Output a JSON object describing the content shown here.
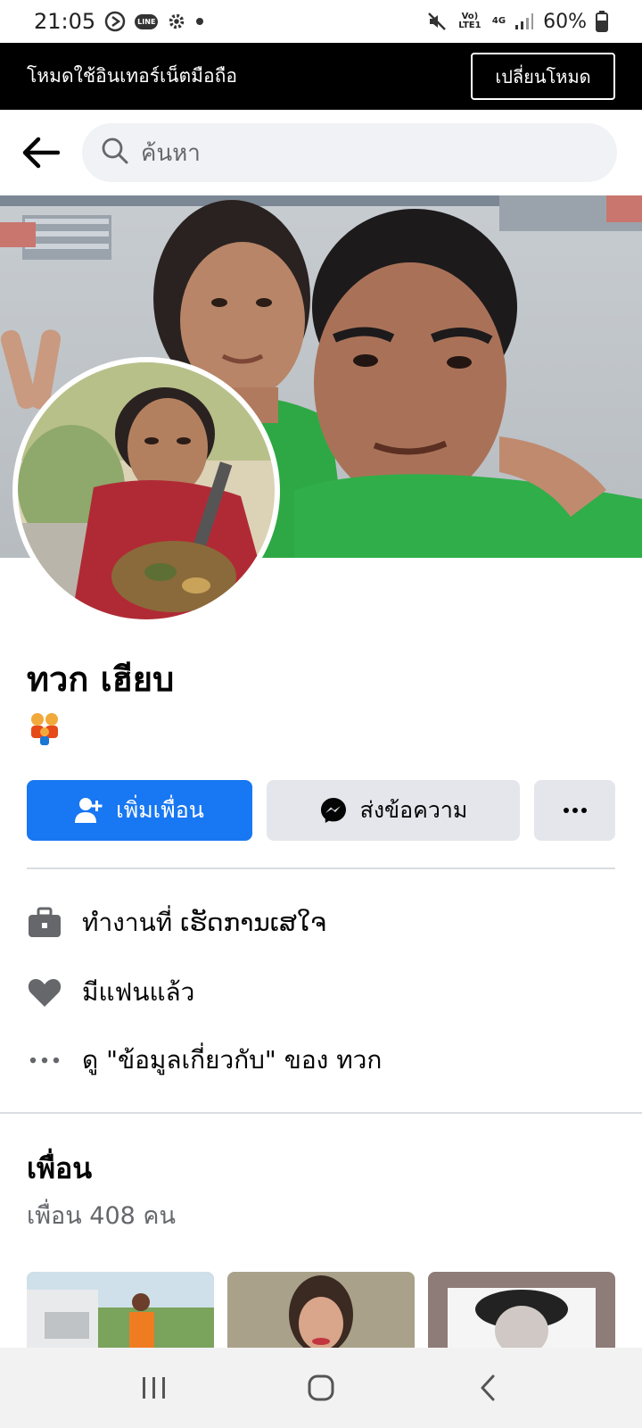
{
  "status_bar": {
    "time": "21:05",
    "line_label": "LINE",
    "volte_label": "Vo) LTE1",
    "network_label": "4G",
    "battery": "60%"
  },
  "mode_banner": {
    "text": "โหมดใช้อินเทอร์เน็ตมือถือ",
    "button": "เปลี่ยนโหมด"
  },
  "search": {
    "placeholder": "ค้นหา"
  },
  "profile": {
    "name": "ทวก เฮียบ",
    "emoji": "👫"
  },
  "actions": {
    "add_friend": "เพิ่มเพื่อน",
    "message": "ส่งข้อความ",
    "more": "···"
  },
  "info": {
    "work": "ทำงานที่ ເຮັດການເສໃຈ",
    "relationship": "มีแฟนแล้ว",
    "about": "ดู \"ข้อมูลเกี่ยวกับ\" ของ ทวก"
  },
  "friends": {
    "title": "เพื่อน",
    "count": "เพื่อน 408 คน"
  },
  "colors": {
    "primary": "#1877f2",
    "secondary_button": "#e4e6eb",
    "banner_bg": "#000000",
    "search_bg": "#f0f2f5"
  }
}
